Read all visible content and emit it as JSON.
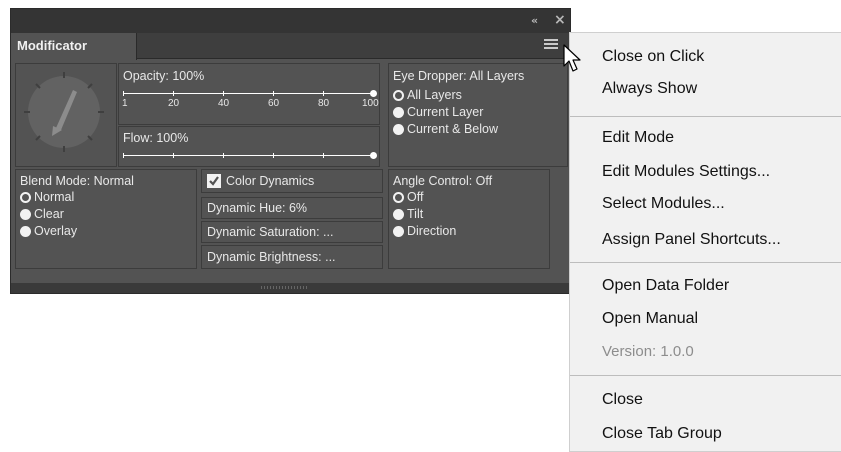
{
  "panel": {
    "topbar": {
      "collapse_icon": "«",
      "close_icon": "×"
    },
    "tab": {
      "label": "Modificator"
    },
    "menu_icon": "hamburger-menu-icon",
    "opacity": {
      "label": "Opacity: 100%",
      "ticks": [
        "1",
        "20",
        "40",
        "60",
        "80",
        "100"
      ],
      "value_percent": 100
    },
    "flow": {
      "label": "Flow: 100%",
      "value_percent": 100
    },
    "eye_dropper": {
      "label": "Eye Dropper: All Layers",
      "options": [
        "All Layers",
        "Current Layer",
        "Current & Below"
      ],
      "selected": "All Layers"
    },
    "blend_mode": {
      "label": "Blend Mode: Normal",
      "options": [
        "Normal",
        "Clear",
        "Overlay"
      ],
      "selected": "Normal"
    },
    "color_dynamics": {
      "label": "Color Dynamics",
      "checked": true,
      "hue": "Dynamic Hue: 6%",
      "saturation": "Dynamic Saturation: ...",
      "brightness": "Dynamic Brightness: ..."
    },
    "angle_control": {
      "label": "Angle Control: Off",
      "options": [
        "Off",
        "Tilt",
        "Direction"
      ],
      "selected": "Off"
    }
  },
  "context_menu": {
    "groups": [
      [
        {
          "label": "Close on Click"
        },
        {
          "label": "Always Show"
        }
      ],
      [
        {
          "label": "Edit Mode"
        },
        {
          "label": "Edit Modules Settings..."
        },
        {
          "label": "Select Modules..."
        },
        {
          "label": "Assign Panel Shortcuts..."
        }
      ],
      [
        {
          "label": "Open Data Folder"
        },
        {
          "label": "Open Manual"
        },
        {
          "label": "Version: 1.0.0",
          "disabled": true
        }
      ],
      [
        {
          "label": "Close"
        },
        {
          "label": "Close Tab Group"
        }
      ]
    ]
  },
  "colors": {
    "panel_bg": "#535353",
    "menu_bg": "#f1f1f1",
    "text_light": "#e8e8e8"
  }
}
